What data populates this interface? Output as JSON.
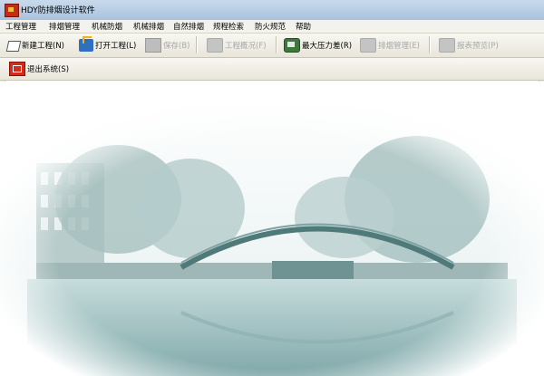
{
  "window": {
    "title": "HDY防排烟设计软件",
    "icon": "app-icon"
  },
  "menu": [
    "工程管理",
    "排烟管理",
    "机械防烟",
    "机械排烟",
    "自然排烟",
    "规程检索",
    "防火规范",
    "帮助"
  ],
  "toolbar": {
    "new_project": "新建工程(N)",
    "open_project": "打开工程(L)",
    "save": "保存(B)",
    "project_overview": "工程概况(F)",
    "max_pressure_diff": "最大压力差(R)",
    "smoke_exhaust_mgmt": "排烟管理(E)",
    "report_preview": "报表预览(P)",
    "exit_system": "退出系统(S)"
  },
  "colors": {
    "titlebar": "#b9cfe6",
    "menubar": "#f4f2ec",
    "toolbar": "#ece9de",
    "disabled_text": "#a8a8a8",
    "scene_tint": "#7fa9aa"
  },
  "icons": [
    "new-document-icon",
    "open-folder-icon",
    "save-disk-icon",
    "overview-icon",
    "pressure-icon",
    "smoke-management-icon",
    "report-preview-icon",
    "exit-icon"
  ]
}
